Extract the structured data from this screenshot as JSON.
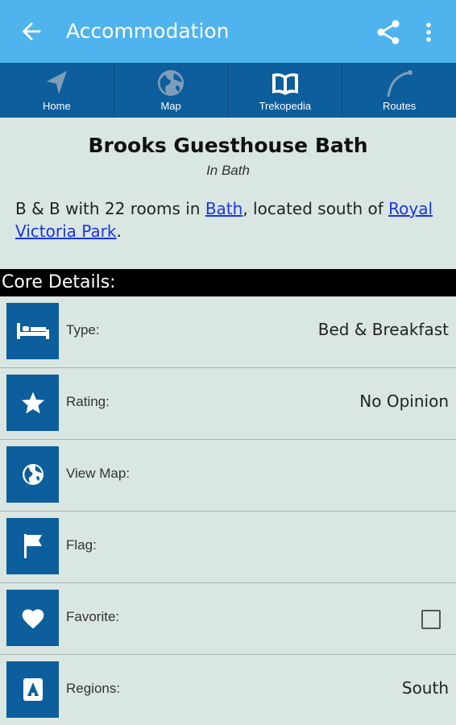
{
  "appbar": {
    "title": "Accommodation",
    "back_icon": "arrow-back-icon",
    "share_icon": "share-icon",
    "more_icon": "more-vert-icon"
  },
  "tabs": [
    {
      "label": "Home",
      "icon": "navigation-icon"
    },
    {
      "label": "Map",
      "icon": "globe-icon"
    },
    {
      "label": "Trekopedia",
      "icon": "book-icon"
    },
    {
      "label": "Routes",
      "icon": "route-icon"
    }
  ],
  "header": {
    "title": "Brooks Guesthouse Bath",
    "subtitle": "In Bath",
    "desc_prefix": "B & B with 22 rooms in ",
    "desc_link1": "Bath",
    "desc_middle": ", located south of ",
    "desc_link2": "Royal Victoria Park",
    "desc_suffix": "."
  },
  "section": {
    "title": "Core Details:"
  },
  "details": [
    {
      "key": "Type:",
      "value": "Bed & Breakfast",
      "icon": "bed-icon"
    },
    {
      "key": "Rating:",
      "value": "No Opinion",
      "icon": "star-icon"
    },
    {
      "key": "View Map:",
      "value": "",
      "icon": "globe-icon"
    },
    {
      "key": "Flag:",
      "value": "",
      "icon": "flag-icon"
    },
    {
      "key": "Favorite:",
      "value": "",
      "icon": "heart-icon",
      "checked": false
    },
    {
      "key": "Regions:",
      "value": "South",
      "icon": "region-icon"
    }
  ],
  "colors": {
    "appbar": "#4fb3ee",
    "tabs": "#0d5e9c",
    "background": "#d9e6e2",
    "link": "#1a35e0"
  }
}
